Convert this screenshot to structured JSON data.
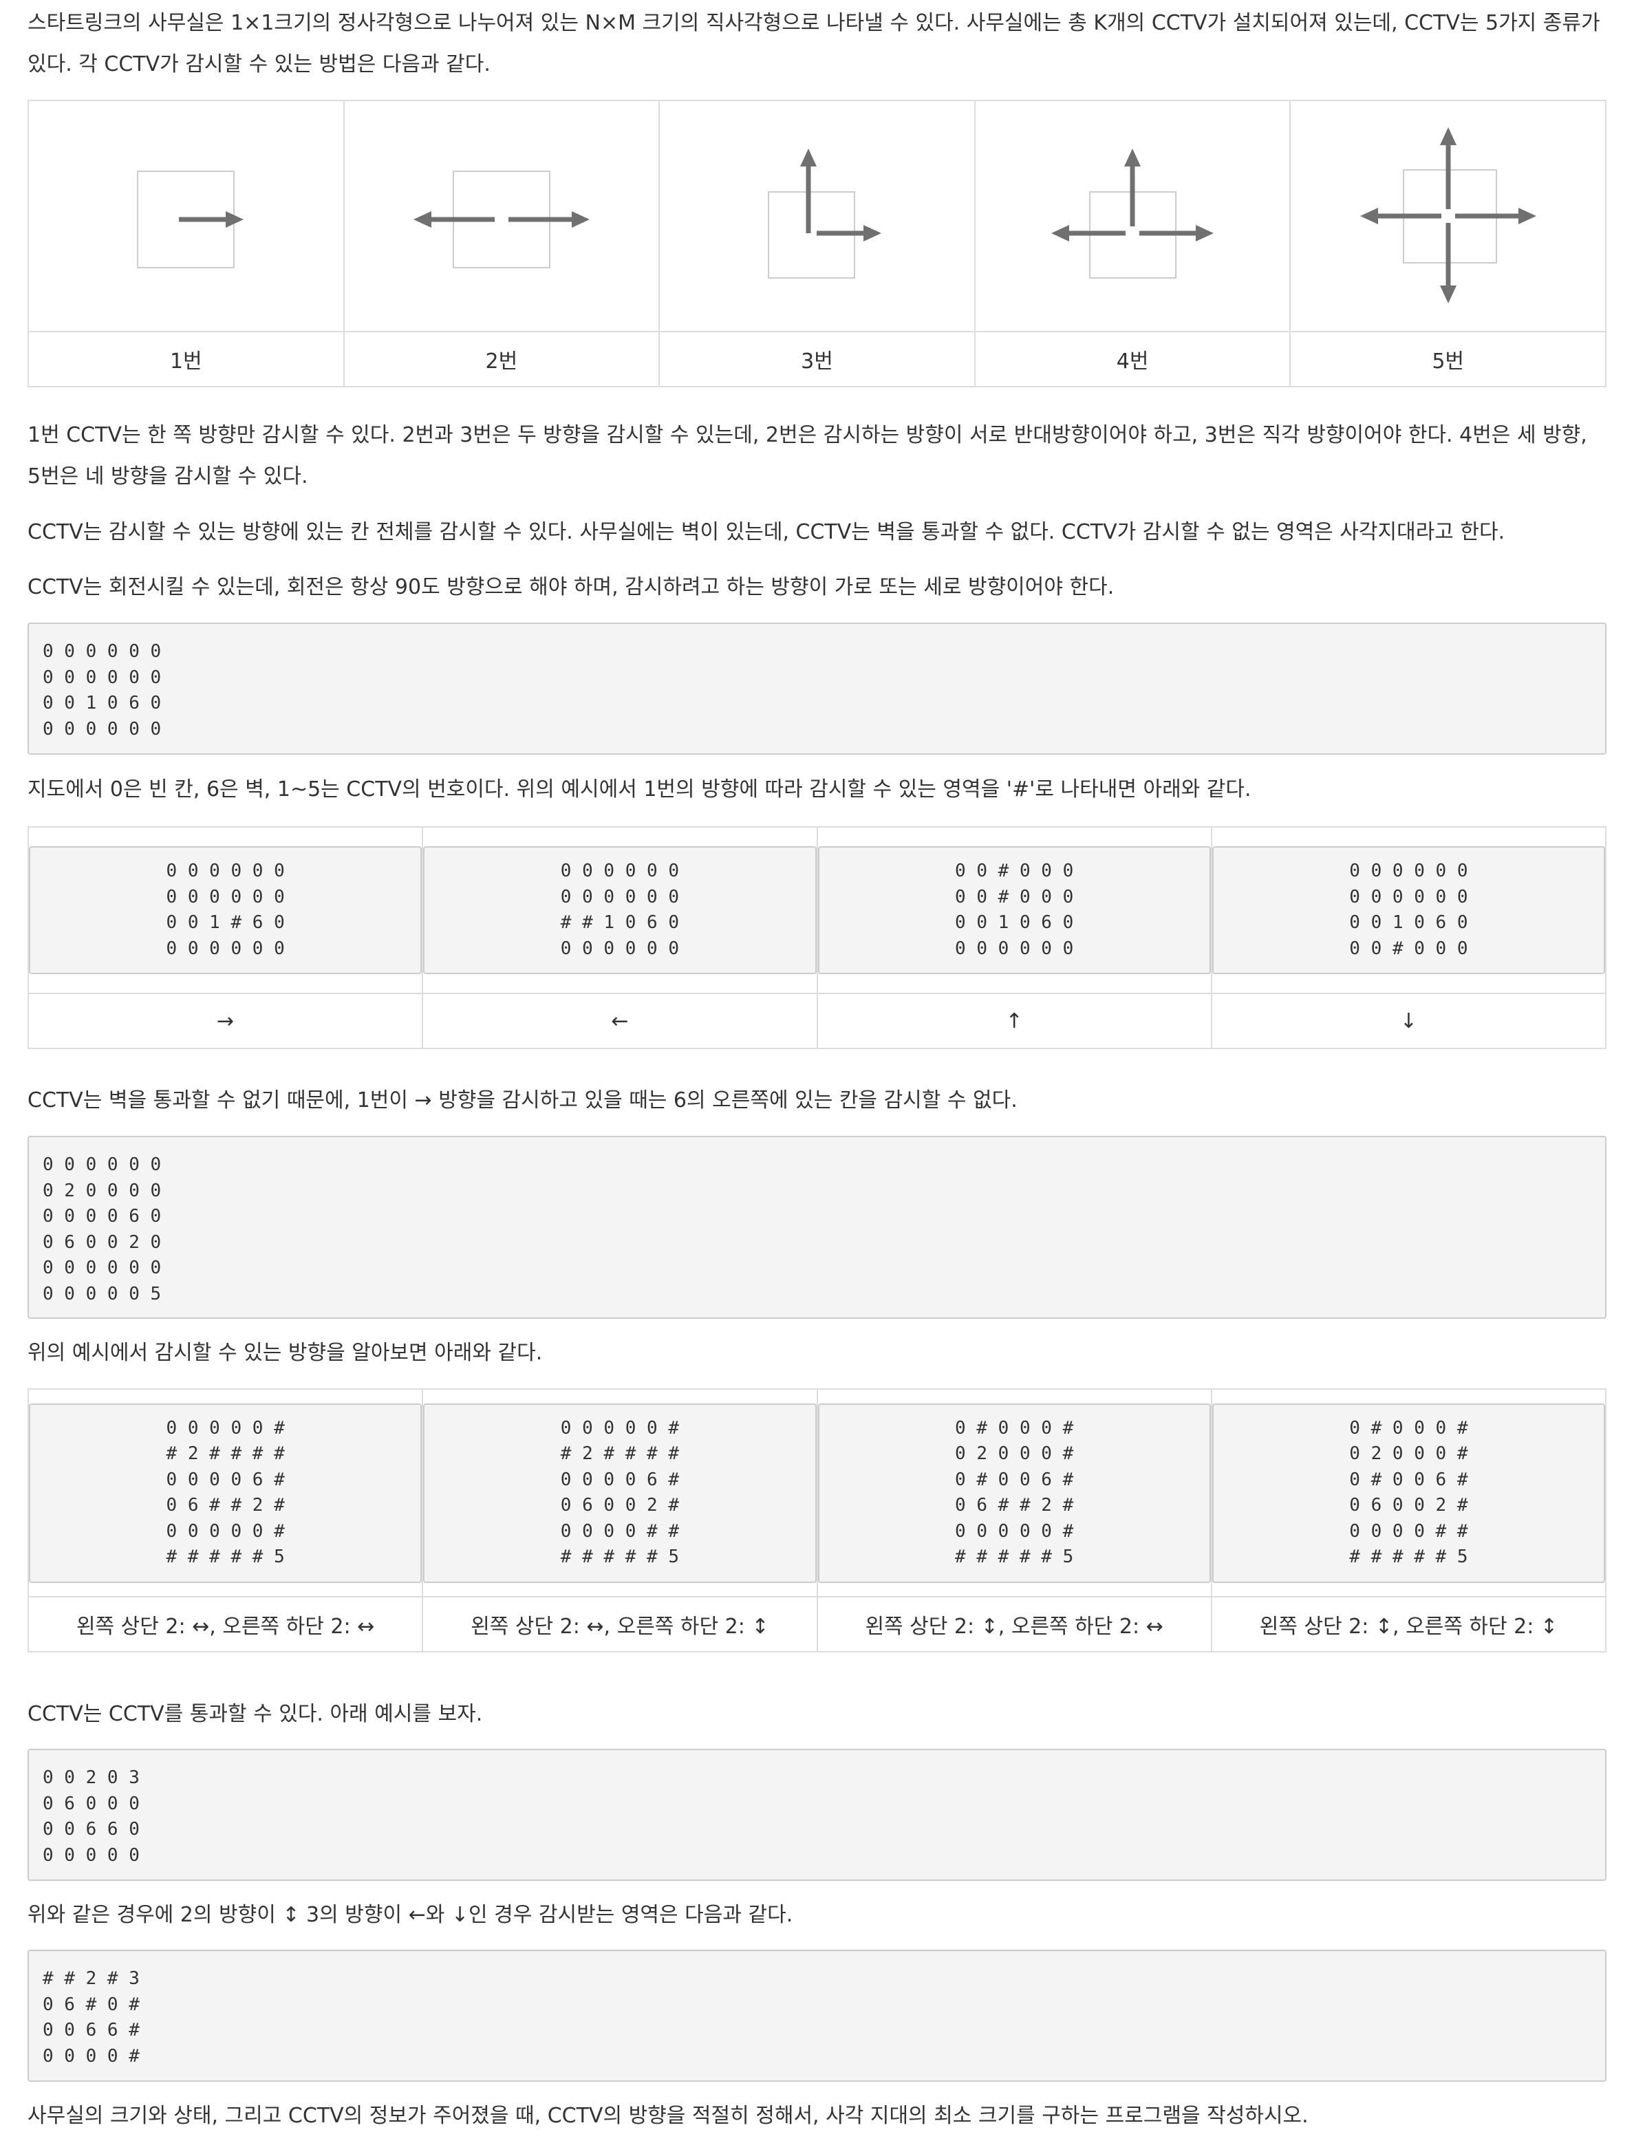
{
  "intro_text": "스타트링크의 사무실은 1×1크기의 정사각형으로 나누어져 있는 N×M 크기의 직사각형으로 나타낼 수 있다. 사무실에는 총 K개의 CCTV가 설치되어져 있는데, CCTV는 5가지 종류가 있다. 각 CCTV가 감시할 수 있는 방법은 다음과 같다.",
  "cctv_types": [
    {
      "label": "1번",
      "icon": "cctv-type-1-icon"
    },
    {
      "label": "2번",
      "icon": "cctv-type-2-icon"
    },
    {
      "label": "3번",
      "icon": "cctv-type-3-icon"
    },
    {
      "label": "4번",
      "icon": "cctv-type-4-icon"
    },
    {
      "label": "5번",
      "icon": "cctv-type-5-icon"
    }
  ],
  "para_directions": "1번 CCTV는 한 쪽 방향만 감시할 수 있다. 2번과 3번은 두 방향을 감시할 수 있는데, 2번은 감시하는 방향이 서로 반대방향이어야 하고, 3번은 직각 방향이어야 한다. 4번은 세 방향, 5번은 네 방향을 감시할 수 있다.",
  "para_walls": "CCTV는 감시할 수 있는 방향에 있는 칸 전체를 감시할 수 있다. 사무실에는 벽이 있는데, CCTV는 벽을 통과할 수 없다. CCTV가 감시할 수 없는 영역은 사각지대라고 한다.",
  "para_rotate": "CCTV는 회전시킬 수 있는데, 회전은 항상 90도 방향으로 해야 하며, 감시하려고 하는 방향이 가로 또는 세로 방향이어야 한다.",
  "example1_map": "0 0 0 0 0 0\n0 0 0 0 0 0\n0 0 1 0 6 0\n0 0 0 0 0 0",
  "para_legend": "지도에서 0은 빈 칸, 6은 벽, 1~5는 CCTV의 번호이다. 위의 예시에서 1번의 방향에 따라 감시할 수 있는 영역을 '#'로 나타내면 아래와 같다.",
  "example1_cases": [
    {
      "map": "0 0 0 0 0 0\n0 0 0 0 0 0\n0 0 1 # 6 0\n0 0 0 0 0 0",
      "label": "→"
    },
    {
      "map": "0 0 0 0 0 0\n0 0 0 0 0 0\n# # 1 0 6 0\n0 0 0 0 0 0",
      "label": "←"
    },
    {
      "map": "0 0 # 0 0 0\n0 0 # 0 0 0\n0 0 1 0 6 0\n0 0 0 0 0 0",
      "label": "↑"
    },
    {
      "map": "0 0 0 0 0 0\n0 0 0 0 0 0\n0 0 1 0 6 0\n0 0 # 0 0 0",
      "label": "↓"
    }
  ],
  "para_wall_block": "CCTV는 벽을 통과할 수 없기 때문에, 1번이 → 방향을 감시하고 있을 때는 6의 오른쪽에 있는 칸을 감시할 수 없다.",
  "example2_map": "0 0 0 0 0 0\n0 2 0 0 0 0\n0 0 0 0 6 0\n0 6 0 0 2 0\n0 0 0 0 0 0\n0 0 0 0 0 5",
  "para_example2": "위의 예시에서 감시할 수 있는 방향을 알아보면 아래와 같다.",
  "example2_cases": [
    {
      "map": "0 0 0 0 0 #\n# 2 # # # #\n0 0 0 0 6 #\n0 6 # # 2 #\n0 0 0 0 0 #\n# # # # # 5",
      "label": "왼쪽 상단 2: ↔, 오른쪽 하단 2: ↔"
    },
    {
      "map": "0 0 0 0 0 #\n# 2 # # # #\n0 0 0 0 6 #\n0 6 0 0 2 #\n0 0 0 0 # #\n# # # # # 5",
      "label": "왼쪽 상단 2: ↔, 오른쪽 하단 2: ↕"
    },
    {
      "map": "0 # 0 0 0 #\n0 2 0 0 0 #\n0 # 0 0 6 #\n0 6 # # 2 #\n0 0 0 0 0 #\n# # # # # 5",
      "label": "왼쪽 상단 2: ↕, 오른쪽 하단 2: ↔"
    },
    {
      "map": "0 # 0 0 0 #\n0 2 0 0 0 #\n0 # 0 0 6 #\n0 6 0 0 2 #\n0 0 0 0 # #\n# # # # # 5",
      "label": "왼쪽 상단 2: ↕, 오른쪽 하단 2: ↕"
    }
  ],
  "para_pass_cctv": "CCTV는 CCTV를 통과할 수 있다. 아래 예시를 보자.",
  "example3_map": "0 0 2 0 3\n0 6 0 0 0\n0 0 6 6 0\n0 0 0 0 0",
  "para_example3": "위와 같은 경우에 2의 방향이 ↕ 3의 방향이 ←와 ↓인 경우 감시받는 영역은 다음과 같다.",
  "example3_result": "# # 2 # 3\n0 6 # 0 #\n0 0 6 6 #\n0 0 0 0 #",
  "para_task": "사무실의 크기와 상태, 그리고 CCTV의 정보가 주어졌을 때, CCTV의 방향을 적절히 정해서, 사각 지대의 최소 크기를 구하는 프로그램을 작성하시오.",
  "colors": {
    "text": "#333333",
    "arrow": "#707070",
    "border": "#dddddd",
    "code_bg": "#f4f4f4"
  }
}
